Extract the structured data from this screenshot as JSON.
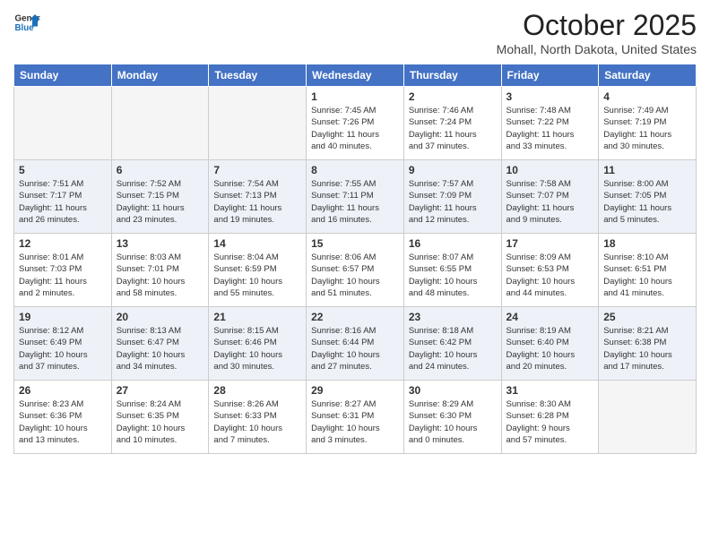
{
  "header": {
    "logo_line1": "General",
    "logo_line2": "Blue",
    "month": "October 2025",
    "location": "Mohall, North Dakota, United States"
  },
  "days_of_week": [
    "Sunday",
    "Monday",
    "Tuesday",
    "Wednesday",
    "Thursday",
    "Friday",
    "Saturday"
  ],
  "weeks": [
    [
      {
        "day": "",
        "info": ""
      },
      {
        "day": "",
        "info": ""
      },
      {
        "day": "",
        "info": ""
      },
      {
        "day": "1",
        "info": "Sunrise: 7:45 AM\nSunset: 7:26 PM\nDaylight: 11 hours\nand 40 minutes."
      },
      {
        "day": "2",
        "info": "Sunrise: 7:46 AM\nSunset: 7:24 PM\nDaylight: 11 hours\nand 37 minutes."
      },
      {
        "day": "3",
        "info": "Sunrise: 7:48 AM\nSunset: 7:22 PM\nDaylight: 11 hours\nand 33 minutes."
      },
      {
        "day": "4",
        "info": "Sunrise: 7:49 AM\nSunset: 7:19 PM\nDaylight: 11 hours\nand 30 minutes."
      }
    ],
    [
      {
        "day": "5",
        "info": "Sunrise: 7:51 AM\nSunset: 7:17 PM\nDaylight: 11 hours\nand 26 minutes."
      },
      {
        "day": "6",
        "info": "Sunrise: 7:52 AM\nSunset: 7:15 PM\nDaylight: 11 hours\nand 23 minutes."
      },
      {
        "day": "7",
        "info": "Sunrise: 7:54 AM\nSunset: 7:13 PM\nDaylight: 11 hours\nand 19 minutes."
      },
      {
        "day": "8",
        "info": "Sunrise: 7:55 AM\nSunset: 7:11 PM\nDaylight: 11 hours\nand 16 minutes."
      },
      {
        "day": "9",
        "info": "Sunrise: 7:57 AM\nSunset: 7:09 PM\nDaylight: 11 hours\nand 12 minutes."
      },
      {
        "day": "10",
        "info": "Sunrise: 7:58 AM\nSunset: 7:07 PM\nDaylight: 11 hours\nand 9 minutes."
      },
      {
        "day": "11",
        "info": "Sunrise: 8:00 AM\nSunset: 7:05 PM\nDaylight: 11 hours\nand 5 minutes."
      }
    ],
    [
      {
        "day": "12",
        "info": "Sunrise: 8:01 AM\nSunset: 7:03 PM\nDaylight: 11 hours\nand 2 minutes."
      },
      {
        "day": "13",
        "info": "Sunrise: 8:03 AM\nSunset: 7:01 PM\nDaylight: 10 hours\nand 58 minutes."
      },
      {
        "day": "14",
        "info": "Sunrise: 8:04 AM\nSunset: 6:59 PM\nDaylight: 10 hours\nand 55 minutes."
      },
      {
        "day": "15",
        "info": "Sunrise: 8:06 AM\nSunset: 6:57 PM\nDaylight: 10 hours\nand 51 minutes."
      },
      {
        "day": "16",
        "info": "Sunrise: 8:07 AM\nSunset: 6:55 PM\nDaylight: 10 hours\nand 48 minutes."
      },
      {
        "day": "17",
        "info": "Sunrise: 8:09 AM\nSunset: 6:53 PM\nDaylight: 10 hours\nand 44 minutes."
      },
      {
        "day": "18",
        "info": "Sunrise: 8:10 AM\nSunset: 6:51 PM\nDaylight: 10 hours\nand 41 minutes."
      }
    ],
    [
      {
        "day": "19",
        "info": "Sunrise: 8:12 AM\nSunset: 6:49 PM\nDaylight: 10 hours\nand 37 minutes."
      },
      {
        "day": "20",
        "info": "Sunrise: 8:13 AM\nSunset: 6:47 PM\nDaylight: 10 hours\nand 34 minutes."
      },
      {
        "day": "21",
        "info": "Sunrise: 8:15 AM\nSunset: 6:46 PM\nDaylight: 10 hours\nand 30 minutes."
      },
      {
        "day": "22",
        "info": "Sunrise: 8:16 AM\nSunset: 6:44 PM\nDaylight: 10 hours\nand 27 minutes."
      },
      {
        "day": "23",
        "info": "Sunrise: 8:18 AM\nSunset: 6:42 PM\nDaylight: 10 hours\nand 24 minutes."
      },
      {
        "day": "24",
        "info": "Sunrise: 8:19 AM\nSunset: 6:40 PM\nDaylight: 10 hours\nand 20 minutes."
      },
      {
        "day": "25",
        "info": "Sunrise: 8:21 AM\nSunset: 6:38 PM\nDaylight: 10 hours\nand 17 minutes."
      }
    ],
    [
      {
        "day": "26",
        "info": "Sunrise: 8:23 AM\nSunset: 6:36 PM\nDaylight: 10 hours\nand 13 minutes."
      },
      {
        "day": "27",
        "info": "Sunrise: 8:24 AM\nSunset: 6:35 PM\nDaylight: 10 hours\nand 10 minutes."
      },
      {
        "day": "28",
        "info": "Sunrise: 8:26 AM\nSunset: 6:33 PM\nDaylight: 10 hours\nand 7 minutes."
      },
      {
        "day": "29",
        "info": "Sunrise: 8:27 AM\nSunset: 6:31 PM\nDaylight: 10 hours\nand 3 minutes."
      },
      {
        "day": "30",
        "info": "Sunrise: 8:29 AM\nSunset: 6:30 PM\nDaylight: 10 hours\nand 0 minutes."
      },
      {
        "day": "31",
        "info": "Sunrise: 8:30 AM\nSunset: 6:28 PM\nDaylight: 9 hours\nand 57 minutes."
      },
      {
        "day": "",
        "info": ""
      }
    ]
  ]
}
